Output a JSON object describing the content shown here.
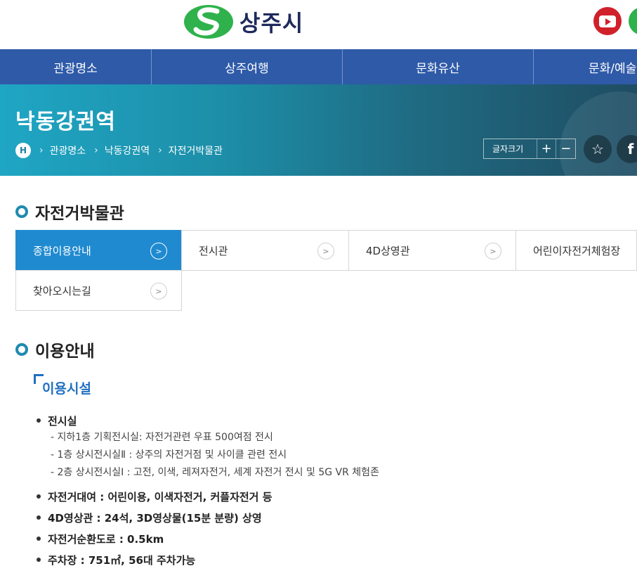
{
  "header": {
    "logo_text": "상주시",
    "brand_colors": {
      "green": "#2fb24c",
      "navy": "#1f2a5c"
    },
    "sns": [
      "youtube-icon",
      "green-sns-icon"
    ]
  },
  "gnb": {
    "items": [
      {
        "label": "관광명소"
      },
      {
        "label": "상주여행"
      },
      {
        "label": "문화유산"
      },
      {
        "label": "문화/예술"
      }
    ],
    "bg_color": "#2e5aa8"
  },
  "visual": {
    "title": "낙동강권역",
    "breadcrumb": [
      "관광명소",
      "낙동강권역",
      "자전거박물관"
    ],
    "home_label": "H",
    "font_size_label": "글자크기",
    "plus": "+",
    "minus": "−",
    "star": "☆",
    "facebook": "f"
  },
  "section": {
    "title": "자전거박물관"
  },
  "tabs": [
    {
      "label": "종합이용안내",
      "active": true
    },
    {
      "label": "전시관",
      "active": false
    },
    {
      "label": "4D상영관",
      "active": false
    },
    {
      "label": "어린이자전거체험장",
      "active": false
    },
    {
      "label": "찾아오시는길",
      "active": false
    }
  ],
  "tab_arrow": ">",
  "usage": {
    "title": "이용안내",
    "subtitle": "이용시설",
    "items": [
      {
        "text": "전시실",
        "sub": [
          "- 지하1층 기획전시실: 자전거관련 우표 500여점 전시",
          "- 1층 상시전시실Ⅱ : 상주의 자전거점 및 사이클 관련 전시",
          "- 2층 상시전시실Ⅰ : 고전, 이색, 레져자전거, 세계 자전거 전시 및 5G VR 체험존"
        ]
      },
      {
        "text": "자전거대여 : 어린이용, 이색자전거, 커플자전거 등"
      },
      {
        "text": "4D영상관 : 24석, 3D영상물(15분 분량) 상영"
      },
      {
        "text": "자전거순환도로 : 0.5km"
      },
      {
        "text": "주차장 : 751㎡, 56대 주차가능"
      }
    ]
  }
}
